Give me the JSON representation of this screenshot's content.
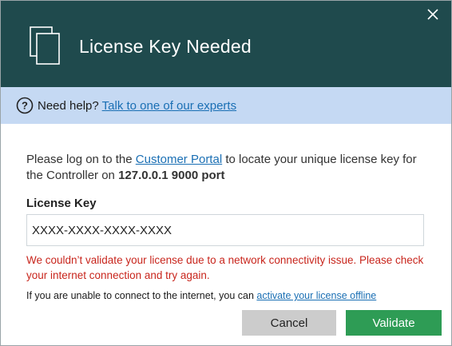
{
  "header": {
    "title": "License Key Needed"
  },
  "help": {
    "prefix": "Need help?",
    "link": "Talk to one of our experts"
  },
  "intro": {
    "before": "Please log on to the",
    "portal_link": "Customer Portal",
    "after": "to locate your unique license key for the Controller on",
    "host": "127.0.0.1 9000 port"
  },
  "license": {
    "label": "License Key",
    "value": "XXXX-XXXX-XXXX-XXXX"
  },
  "error": "We couldn’t validate your license due to a network connectivity issue. Please check your internet connection and try again.",
  "offline": {
    "text": "If you are unable to connect to the internet, you can",
    "link": "activate your license offline"
  },
  "buttons": {
    "cancel": "Cancel",
    "validate": "Validate"
  },
  "colors": {
    "header_bg": "#1f4a4d",
    "help_bg": "#c5d9f3",
    "link": "#1a6fb4",
    "error": "#c8251c",
    "validate_bg": "#2e9c55",
    "cancel_bg": "#cccccc"
  },
  "icons": {
    "header": "document-icon",
    "close": "close-icon",
    "help": "question-circle-icon"
  }
}
